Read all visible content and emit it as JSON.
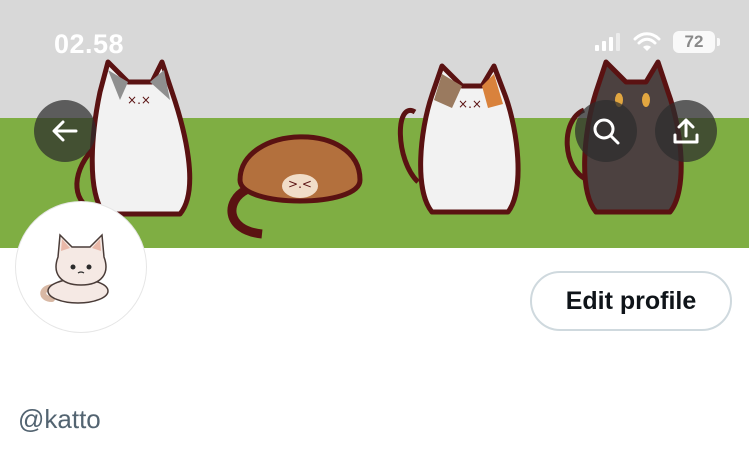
{
  "status_bar": {
    "time": "02.58",
    "battery": "72",
    "icons": [
      "signal-icon",
      "wifi-icon",
      "battery-icon"
    ]
  },
  "header": {
    "back_icon": "back-arrow-icon",
    "search_icon": "search-icon",
    "share_icon": "share-icon"
  },
  "profile": {
    "edit_button_label": "Edit profile",
    "handle": "@katto"
  },
  "colors": {
    "banner_sky": "#d8d8d8",
    "banner_grass": "#7fae43",
    "cat_outline": "#5a1212",
    "handle_text": "#536471",
    "button_border": "#cfd9de"
  }
}
